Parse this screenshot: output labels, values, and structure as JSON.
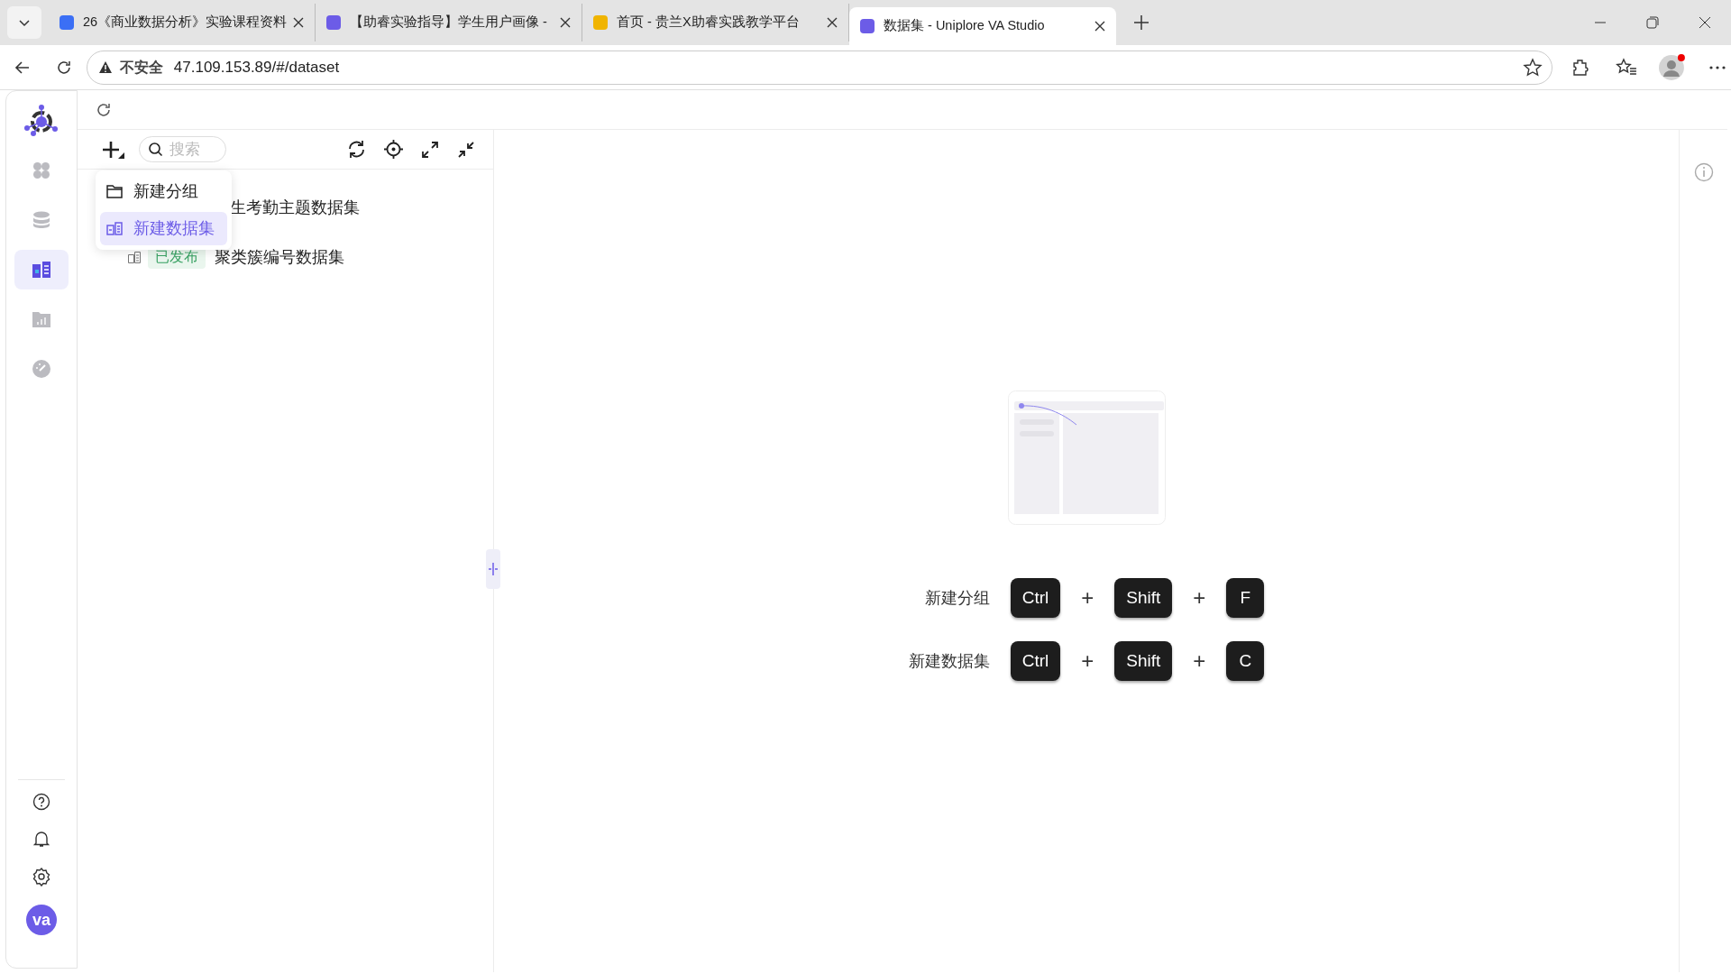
{
  "browser": {
    "tabs": [
      {
        "label": "26《商业数据分析》实验课程资料",
        "selected": false
      },
      {
        "label": "【助睿实验指导】学生用户画像 - ",
        "selected": false
      },
      {
        "label": "首页 - 贵兰X助睿实践教学平台",
        "selected": false
      },
      {
        "label": "数据集 - Uniplore VA Studio",
        "selected": true
      }
    ],
    "security_label": "不安全",
    "url": "47.109.153.89/#/dataset"
  },
  "sidebar": {
    "items": [
      {
        "selected": false
      },
      {
        "selected": false
      },
      {
        "selected": true
      },
      {
        "selected": false
      },
      {
        "selected": false
      }
    ],
    "avatar": "va"
  },
  "panel": {
    "search": {
      "placeholder": "搜索"
    },
    "tree": [
      {
        "label": "生考勤主题数据集"
      },
      {
        "label": "聚类簇编号数据集",
        "badge": "已发布"
      }
    ],
    "menu": [
      {
        "label": "新建分组",
        "selected": false
      },
      {
        "label": "新建数据集",
        "selected": true
      }
    ]
  },
  "shortcuts": [
    {
      "label": "新建分组",
      "keys": [
        {
          "kind": "key",
          "text": "Ctrl"
        },
        {
          "kind": "plus",
          "text": "+"
        },
        {
          "kind": "key",
          "text": "Shift"
        },
        {
          "kind": "plus",
          "text": "+"
        },
        {
          "kind": "key",
          "text": "F"
        }
      ]
    },
    {
      "label": "新建数据集",
      "keys": [
        {
          "kind": "key",
          "text": "Ctrl"
        },
        {
          "kind": "plus",
          "text": "+"
        },
        {
          "kind": "key",
          "text": "Shift"
        },
        {
          "kind": "plus",
          "text": "+"
        },
        {
          "kind": "key",
          "text": "C"
        }
      ]
    }
  ]
}
